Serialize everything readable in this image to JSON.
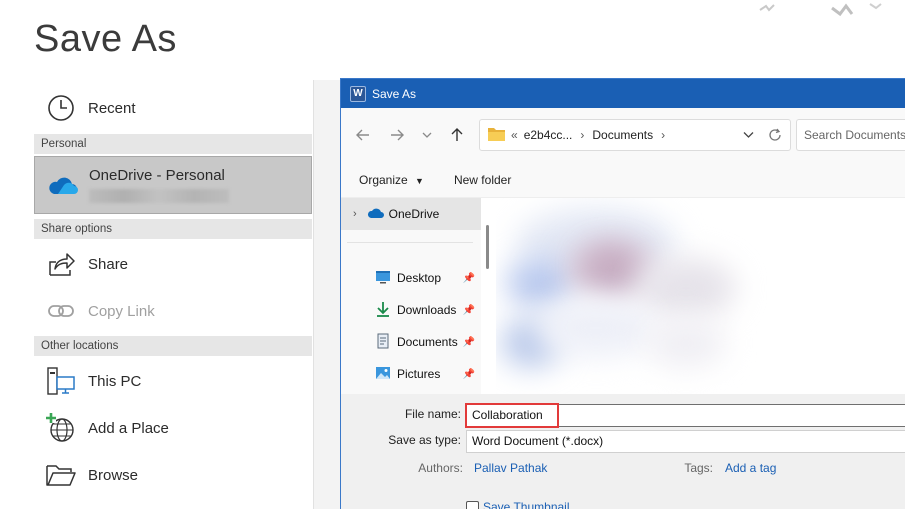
{
  "backstage": {
    "title": "Save As",
    "recent": "Recent",
    "section_personal": "Personal",
    "onedrive_label": "OneDrive - Personal",
    "section_share": "Share options",
    "share": "Share",
    "copy_link": "Copy Link",
    "section_other": "Other locations",
    "this_pc": "This PC",
    "add_place": "Add a Place",
    "browse": "Browse"
  },
  "dialog": {
    "title": "Save As",
    "app_icon_letter": "W",
    "breadcrumb": {
      "overflow": "«",
      "folder1": "e2b4cc...",
      "sep": "›",
      "folder2": "Documents"
    },
    "search_placeholder": "Search Documents",
    "toolbar": {
      "organize": "Organize",
      "new_folder": "New folder"
    },
    "nav": {
      "onedrive": "OneDrive",
      "desktop": "Desktop",
      "downloads": "Downloads",
      "documents": "Documents",
      "pictures": "Pictures"
    },
    "form": {
      "file_name_label": "File name:",
      "file_name_value": "Collaboration",
      "save_type_label": "Save as type:",
      "save_type_value": "Word Document (*.docx)",
      "authors_label": "Authors:",
      "authors_value": "Pallav Pathak",
      "tags_label": "Tags:",
      "tags_value": "Add a tag",
      "thumbnail_label": "Save Thumbnail"
    }
  },
  "colors": {
    "accent": "#1a5fb4",
    "highlight": "#e23a3a",
    "onedrive": "#0f6cbd"
  }
}
